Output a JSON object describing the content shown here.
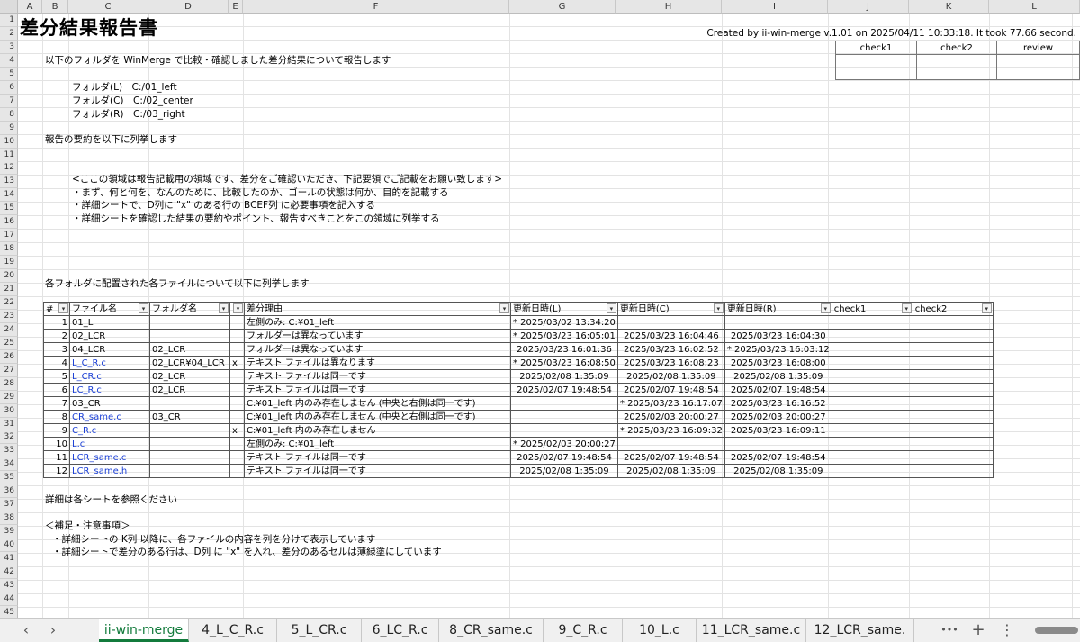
{
  "columns": [
    "A",
    "B",
    "C",
    "D",
    "E",
    "F",
    "G",
    "H",
    "I",
    "J",
    "K",
    "L"
  ],
  "rows": [
    "1",
    "2",
    "3",
    "4",
    "5",
    "6",
    "7",
    "8",
    "9",
    "10",
    "11",
    "12",
    "13",
    "14",
    "15",
    "16",
    "17",
    "18",
    "19",
    "20",
    "21",
    "22",
    "23",
    "24",
    "25",
    "26",
    "27",
    "28",
    "29",
    "30",
    "31",
    "32",
    "33",
    "34",
    "35",
    "36",
    "37",
    "38",
    "39",
    "40",
    "41",
    "42",
    "43",
    "44",
    "45"
  ],
  "title": "差分結果報告書",
  "created": "Created by ii-win-merge v.1.01 on 2025/04/11 10:33:18. It took 77.66 second.",
  "check_headers": [
    "check1",
    "check2",
    "review"
  ],
  "intro": "以下のフォルダを WinMerge で比較・確認しました差分結果について報告します",
  "folders": [
    "フォルダ(L)　C:/01_left",
    "フォルダ(C)　C:/02_center",
    "フォルダ(R)　C:/03_right"
  ],
  "summary_label": "報告の要約を以下に列挙します",
  "notes": [
    "<ここの領域は報告記載用の領域です、差分をご確認いただき、下記要領でご記載をお願い致します>",
    "・まず、何と何を、なんのために、比較したのか、ゴールの状態は何か、目的を記載する",
    "・詳細シートで、D列に \"x\" のある行の BCEF列 に必要事項を記入する",
    "・詳細シートを確認した結果の要約やポイント、報告すべきことをこの領域に列挙する"
  ],
  "list_label": "各フォルダに配置された各ファイルについて以下に列挙します",
  "table": {
    "headers": [
      "#",
      "ファイル名",
      "フォルダ名",
      "",
      "差分理由",
      "更新日時(L)",
      "更新日時(C)",
      "更新日時(R)",
      "check1",
      "check2"
    ],
    "rows": [
      [
        "1",
        "01_L",
        "",
        "",
        "左側のみ: C:¥01_left",
        "* 2025/03/02 13:34:20",
        "",
        "",
        "",
        ""
      ],
      [
        "2",
        "02_LCR",
        "",
        "",
        "フォルダーは異なっています",
        "* 2025/03/23 16:05:01",
        "2025/03/23 16:04:46",
        "2025/03/23 16:04:30",
        "",
        ""
      ],
      [
        "3",
        "04_LCR",
        "02_LCR",
        "",
        "フォルダーは異なっています",
        "2025/03/23 16:01:36",
        "2025/03/23 16:02:52",
        "* 2025/03/23 16:03:12",
        "",
        ""
      ],
      [
        "4",
        "L_C_R.c",
        "02_LCR¥04_LCR",
        "x",
        "テキスト ファイルは異なります",
        "* 2025/03/23 16:08:50",
        "2025/03/23 16:08:23",
        "2025/03/23 16:08:00",
        "",
        ""
      ],
      [
        "5",
        "L_CR.c",
        "02_LCR",
        "",
        "テキスト ファイルは同一です",
        "2025/02/08 1:35:09",
        "2025/02/08 1:35:09",
        "2025/02/08 1:35:09",
        "",
        ""
      ],
      [
        "6",
        "LC_R.c",
        "02_LCR",
        "",
        "テキスト ファイルは同一です",
        "2025/02/07 19:48:54",
        "2025/02/07 19:48:54",
        "2025/02/07 19:48:54",
        "",
        ""
      ],
      [
        "7",
        "03_CR",
        "",
        "",
        "C:¥01_left 内のみ存在しません (中央と右側は同一です)",
        "",
        "* 2025/03/23 16:17:07",
        "2025/03/23 16:16:52",
        "",
        ""
      ],
      [
        "8",
        "CR_same.c",
        "03_CR",
        "",
        "C:¥01_left 内のみ存在しません (中央と右側は同一です)",
        "",
        "2025/02/03 20:00:27",
        "2025/02/03 20:00:27",
        "",
        ""
      ],
      [
        "9",
        "C_R.c",
        "",
        "x",
        "C:¥01_left 内のみ存在しません",
        "",
        "* 2025/03/23 16:09:32",
        "2025/03/23 16:09:11",
        "",
        ""
      ],
      [
        "10",
        "L.c",
        "",
        "",
        "左側のみ: C:¥01_left",
        "* 2025/02/03 20:00:27",
        "",
        "",
        "",
        ""
      ],
      [
        "11",
        "LCR_same.c",
        "",
        "",
        "テキスト ファイルは同一です",
        "2025/02/07 19:48:54",
        "2025/02/07 19:48:54",
        "2025/02/07 19:48:54",
        "",
        ""
      ],
      [
        "12",
        "LCR_same.h",
        "",
        "",
        "テキスト ファイルは同一です",
        "2025/02/08 1:35:09",
        "2025/02/08 1:35:09",
        "2025/02/08 1:35:09",
        "",
        ""
      ]
    ]
  },
  "detail_label": "詳細は各シートを参照ください",
  "supplement_title": "＜補足・注意事項＞",
  "supplement": [
    "・詳細シートの K列 以降に、各ファイルの内容を列を分けて表示しています",
    "・詳細シートで差分のある行は、D列 に \"x\" を入れ、差分のあるセルは薄緑塗にしています"
  ],
  "tabs": [
    "ii-win-merge",
    "4_L_C_R.c",
    "5_L_CR.c",
    "6_LC_R.c",
    "8_CR_same.c",
    "9_C_R.c",
    "10_L.c",
    "11_LCR_same.c",
    "12_LCR_same."
  ],
  "tab_nav": {
    "prev": "‹",
    "next": "›",
    "more": "•••",
    "add": "+",
    "menu": "⋮"
  },
  "active_tab": "ii-win-merge",
  "link_color": "#1a3fd6",
  "active_tab_color": "#137b3c"
}
